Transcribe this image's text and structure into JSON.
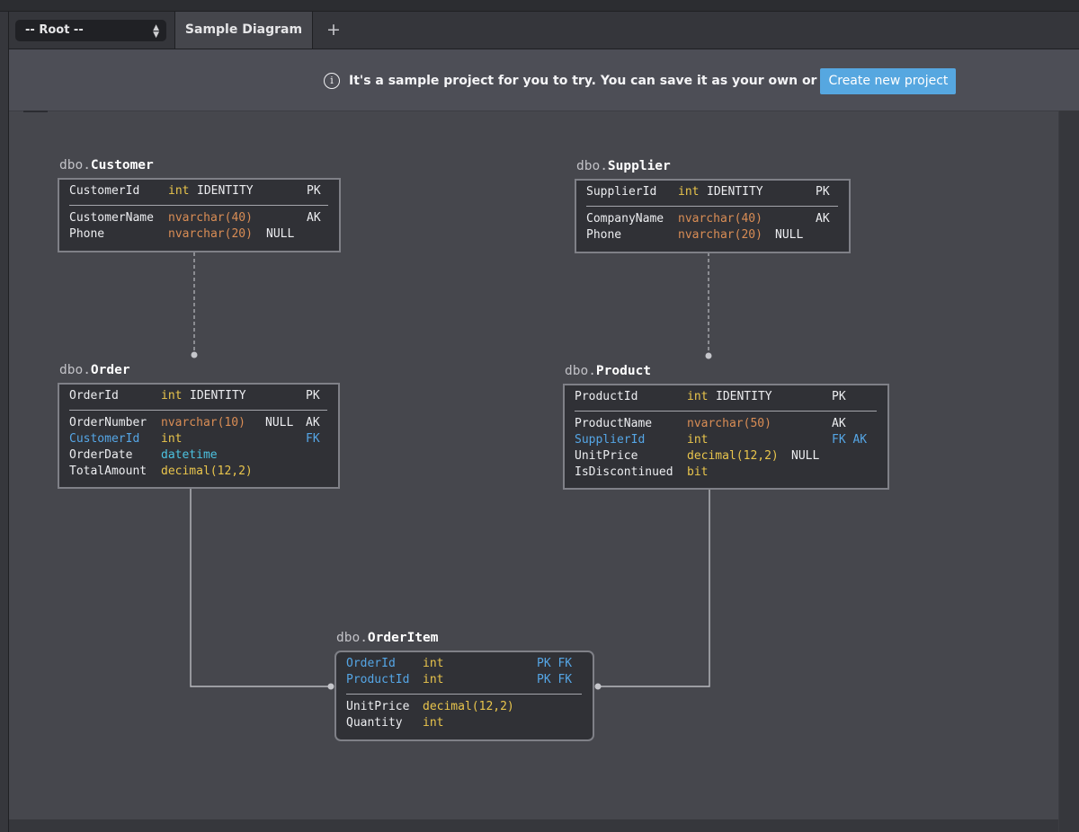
{
  "toolbar": {
    "root_select": "-- Root --",
    "tabs": [
      {
        "label": "Sample Diagram",
        "active": true
      }
    ],
    "add_tab_label": "+"
  },
  "banner": {
    "icon": "info-icon",
    "message": "It's a sample project for you to try. You can save it as your own or",
    "button_label": "Create new project",
    "button_color": "#56a7e0"
  },
  "colors": {
    "background": "#46474d",
    "table_fill": "#303136",
    "fk_color": "#55a6e6",
    "int_color": "#e9c54c",
    "nvarchar_color": "#d98d55",
    "datetime_color": "#4cc2e0"
  },
  "tables": {
    "customer": {
      "schema": "dbo.",
      "name": "Customer",
      "pk_rows": [
        {
          "column": "CustomerId",
          "type": "int",
          "extra": "IDENTITY",
          "null": "",
          "keys": "PK",
          "fk": false
        }
      ],
      "rows": [
        {
          "column": "CustomerName",
          "type": "nvarchar(40)",
          "extra": "",
          "null": "",
          "keys": "AK",
          "fk": false
        },
        {
          "column": "Phone",
          "type": "nvarchar(20)",
          "extra": "",
          "null": "NULL",
          "keys": "",
          "fk": false
        }
      ]
    },
    "supplier": {
      "schema": "dbo.",
      "name": "Supplier",
      "pk_rows": [
        {
          "column": "SupplierId",
          "type": "int",
          "extra": "IDENTITY",
          "null": "",
          "keys": "PK",
          "fk": false
        }
      ],
      "rows": [
        {
          "column": "CompanyName",
          "type": "nvarchar(40)",
          "extra": "",
          "null": "",
          "keys": "AK",
          "fk": false
        },
        {
          "column": "Phone",
          "type": "nvarchar(20)",
          "extra": "",
          "null": "NULL",
          "keys": "",
          "fk": false
        }
      ]
    },
    "order": {
      "schema": "dbo.",
      "name": "Order",
      "pk_rows": [
        {
          "column": "OrderId",
          "type": "int",
          "extra": "IDENTITY",
          "null": "",
          "keys": "PK",
          "fk": false
        }
      ],
      "rows": [
        {
          "column": "OrderNumber",
          "type": "nvarchar(10)",
          "extra": "",
          "null": "NULL",
          "keys": "AK",
          "fk": false
        },
        {
          "column": "CustomerId",
          "type": "int",
          "extra": "",
          "null": "",
          "keys": "FK",
          "fk": true
        },
        {
          "column": "OrderDate",
          "type": "datetime",
          "extra": "",
          "null": "",
          "keys": "",
          "fk": false
        },
        {
          "column": "TotalAmount",
          "type": "decimal(12,2)",
          "extra": "",
          "null": "",
          "keys": "",
          "fk": false
        }
      ]
    },
    "product": {
      "schema": "dbo.",
      "name": "Product",
      "pk_rows": [
        {
          "column": "ProductId",
          "type": "int",
          "extra": "IDENTITY",
          "null": "",
          "keys": "PK",
          "fk": false
        }
      ],
      "rows": [
        {
          "column": "ProductName",
          "type": "nvarchar(50)",
          "extra": "",
          "null": "",
          "keys": "AK",
          "fk": false
        },
        {
          "column": "SupplierId",
          "type": "int",
          "extra": "",
          "null": "",
          "keys": "FK AK",
          "fk": true
        },
        {
          "column": "UnitPrice",
          "type": "decimal(12,2)",
          "extra": "",
          "null": "NULL",
          "keys": "",
          "fk": false
        },
        {
          "column": "IsDiscontinued",
          "type": "bit",
          "extra": "",
          "null": "",
          "keys": "",
          "fk": false
        }
      ]
    },
    "orderitem": {
      "schema": "dbo.",
      "name": "OrderItem",
      "pk_rows": [
        {
          "column": "OrderId",
          "type": "int",
          "extra": "",
          "null": "",
          "keys": "PK FK",
          "fk": true
        },
        {
          "column": "ProductId",
          "type": "int",
          "extra": "",
          "null": "",
          "keys": "PK FK",
          "fk": true
        }
      ],
      "rows": [
        {
          "column": "UnitPrice",
          "type": "decimal(12,2)",
          "extra": "",
          "null": "",
          "keys": "",
          "fk": false
        },
        {
          "column": "Quantity",
          "type": "int",
          "extra": "",
          "null": "",
          "keys": "",
          "fk": false
        }
      ]
    }
  },
  "relationships": [
    {
      "from": "Customer",
      "to": "Order",
      "style": "dashed"
    },
    {
      "from": "Supplier",
      "to": "Product",
      "style": "dashed"
    },
    {
      "from": "Order",
      "to": "OrderItem",
      "style": "solid"
    },
    {
      "from": "Product",
      "to": "OrderItem",
      "style": "solid"
    }
  ]
}
